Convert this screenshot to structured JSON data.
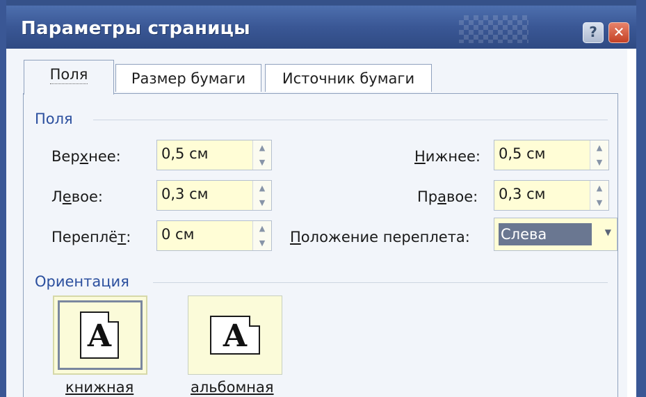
{
  "window": {
    "title": "Параметры страницы",
    "help_label": "?",
    "close_label": "✕"
  },
  "tabs": [
    {
      "label": "Поля",
      "active": true
    },
    {
      "label": "Размер бумаги",
      "active": false
    },
    {
      "label": "Источник бумаги",
      "active": false
    }
  ],
  "margins": {
    "section_title": "Поля",
    "top": {
      "label_pre": "Вер",
      "label_key": "х",
      "label_post": "нее:",
      "value": "0,5 см"
    },
    "bottom": {
      "label_pre": "",
      "label_key": "Н",
      "label_post": "ижнее:",
      "value": "0,5 см"
    },
    "left": {
      "label_pre": "Л",
      "label_key": "е",
      "label_post": "вое:",
      "value": "0,3 см"
    },
    "right": {
      "label_pre": "Пр",
      "label_key": "а",
      "label_post": "вое:",
      "value": "0,3 см"
    },
    "gutter": {
      "label_pre": "Переплё",
      "label_key": "т",
      "label_post": ":",
      "value": "0 см"
    },
    "gutter_position": {
      "label_pre": "",
      "label_key": "П",
      "label_post": "оложение переплета:",
      "value": "Слева"
    }
  },
  "orientation": {
    "section_title": "Ориентация",
    "portrait_label": "книжная",
    "landscape_label": "альбомная",
    "glyph": "A",
    "selected": "portrait"
  },
  "colors": {
    "titlebar": "#3a5795",
    "section_title": "#2b4f9e",
    "field_bg": "#fffdd6",
    "selection": "#6a7791"
  }
}
